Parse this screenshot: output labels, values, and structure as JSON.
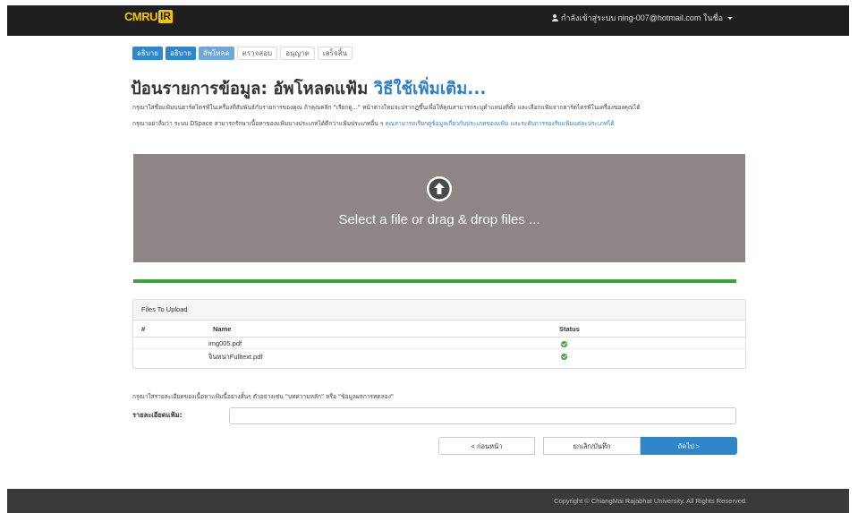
{
  "header": {
    "logo_text": "CMRU",
    "logo_badge": "IR",
    "user_text": "กำลังเข้าสู่ระบบ ning-007@hotmail.com ในชื่อ"
  },
  "steps": [
    {
      "label": "อธิบาย",
      "state": "done"
    },
    {
      "label": "อธิบาย",
      "state": "done"
    },
    {
      "label": "อัพโหลด",
      "state": "active"
    },
    {
      "label": "ตรวจสอบ",
      "state": "todo"
    },
    {
      "label": "อนุญาต",
      "state": "todo"
    },
    {
      "label": "เสร็จสิ้น",
      "state": "todo"
    }
  ],
  "page": {
    "title": "ป้อนรายการข้อมูล: อัพโหลดแฟ้ม",
    "title_more": "วิธีใช้เพิ่มเติม...",
    "help_line1": "กรุณาใส่ชื่อแฟ้มบนฮาร์ดไดรฟ์ในเครื่องที่สัมพันธ์กับรายการของคุณ ถ้าคุณคลิก \"เรียกดู...\" หน้าต่างใหม่จะปรากฏขึ้นเพื่อให้คุณสามารถระบุตำแหน่งที่ตั้ง และเลือกแฟ้มจากฮาร์ดไดรฟ์ในเครื่องของคุณได้",
    "help_line2_prefix": "กรุณาอย่าลืมว่า ระบบ DSpace สามารถรักษาเนื้อหาของแฟ้มบางประเภทได้ดีกว่าแฟ้มประเภทอื่น ๆ",
    "help_line2_link": "คุณสามารถเรียกดูข้อมูลเกี่ยวกับประเภทของแฟ้ม และระดับการรองรับแฟ้มแต่ละประเภทได้"
  },
  "dropzone": {
    "icon": "upload-arrow-circle-icon",
    "text": "Select a file or drag & drop files ..."
  },
  "progress": {
    "percent": 100,
    "color": "#3aa43a"
  },
  "files_panel": {
    "title": "Files To Upload",
    "columns": [
      "#",
      "Name",
      "Status"
    ],
    "rows": [
      {
        "name": "img005.pdf",
        "status_icon": "check-circle-icon"
      },
      {
        "name": "จินทนาFulltext.pdf",
        "status_icon": "check-circle-icon"
      }
    ]
  },
  "description": {
    "help": "กรุณาใส่รายละเอียดของเนื้อหาแฟ้มนี้อย่างสั้นๆ ตัวอย่างเช่น \"บทความหลัก\" หรือ \"ข้อมูลผลการทดลอง\"",
    "label": "รายละเอียดแฟ้ม:",
    "value": "",
    "placeholder": ""
  },
  "buttons": {
    "prev": "< ก่อนหน้า",
    "cancel": "ยกเลิก/บันทึก",
    "next": "ถัดไป >"
  },
  "footer": {
    "copyright": "Copyright © ChiangMai Rajabhat University. All Rights Reserved."
  },
  "colors": {
    "accent": "#2f86c9",
    "dropzone": "#8e8686",
    "success": "#3aa43a",
    "topbar": "#1f1f1f"
  }
}
